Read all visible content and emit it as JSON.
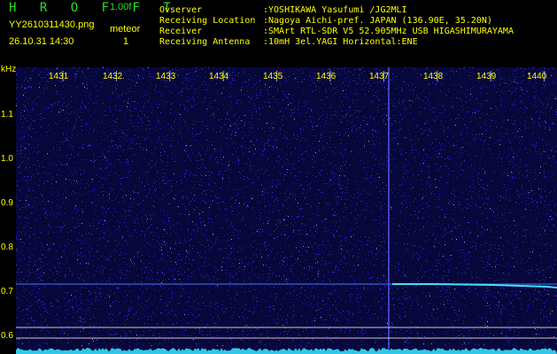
{
  "header": {
    "app_name": "H R O F F T",
    "version": "1.00f",
    "filename": "YY2610311430.png",
    "datetime": "26.10.31 14:30",
    "meteor_label": "meteor",
    "meteor_count": "1",
    "info_rows": [
      {
        "label": "Ovserver",
        "value": ":YOSHIKAWA Yasufumi /JG2MLI"
      },
      {
        "label": "Receiving Location",
        "value": ":Nagoya Aichi-pref. JAPAN (136.90E, 35.20N)"
      },
      {
        "label": "Receiver",
        "value": ":SMArt RTL-SDR V5 52.905MHz USB HIGASHIMURAYAMA"
      },
      {
        "label": "Receiving Antenna",
        "value": ":10mH 3el.YAGI Horizontal:ENE"
      }
    ]
  },
  "colors": {
    "header_text": "#ffff00",
    "title_text": "#22e022",
    "background": "#000000",
    "noise": "#1a1aa8",
    "signal": "#40e0ff"
  },
  "spectrogram": {
    "unit_label": "kHz",
    "x_ticks": [
      "1431",
      "1432",
      "1433",
      "1434",
      "1435",
      "1436",
      "1437",
      "1438",
      "1439",
      "1440"
    ],
    "y_ticks": [
      "1.1",
      "1.0",
      "0.9",
      "0.8",
      "0.7",
      "0.6"
    ]
  }
}
